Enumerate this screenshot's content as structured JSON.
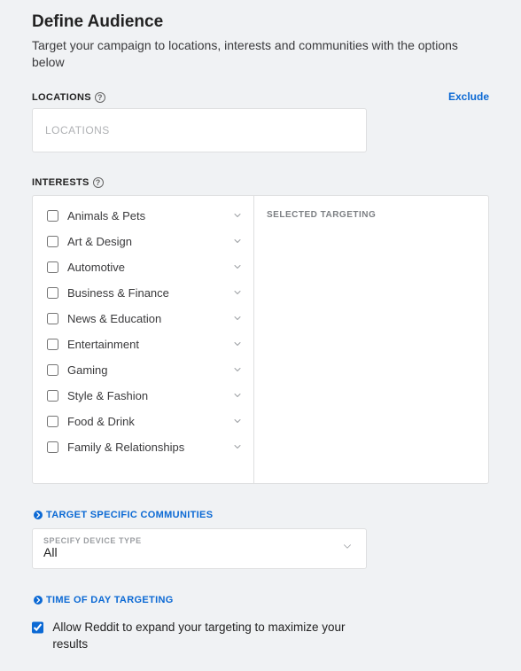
{
  "header": {
    "title": "Define Audience",
    "subtitle": "Target your campaign to locations, interests and communities with the options below"
  },
  "locations": {
    "label": "LOCATIONS",
    "input_placeholder": "LOCATIONS",
    "exclude_label": "Exclude"
  },
  "interests": {
    "label": "INTERESTS",
    "selected_targeting_label": "SELECTED TARGETING",
    "items": [
      {
        "label": "Animals & Pets",
        "checked": false
      },
      {
        "label": "Art & Design",
        "checked": false
      },
      {
        "label": "Automotive",
        "checked": false
      },
      {
        "label": "Business & Finance",
        "checked": false
      },
      {
        "label": "News & Education",
        "checked": false
      },
      {
        "label": "Entertainment",
        "checked": false
      },
      {
        "label": "Gaming",
        "checked": false
      },
      {
        "label": "Style & Fashion",
        "checked": false
      },
      {
        "label": "Food & Drink",
        "checked": false
      },
      {
        "label": "Family & Relationships",
        "checked": false
      }
    ]
  },
  "communities": {
    "toggle_label": "TARGET SPECIFIC COMMUNITIES"
  },
  "device": {
    "field_label": "SPECIFY DEVICE TYPE",
    "value": "All"
  },
  "time_of_day": {
    "toggle_label": "TIME OF DAY TARGETING"
  },
  "expand_targeting": {
    "label": "Allow Reddit to expand your targeting to maximize your results",
    "checked": true
  }
}
